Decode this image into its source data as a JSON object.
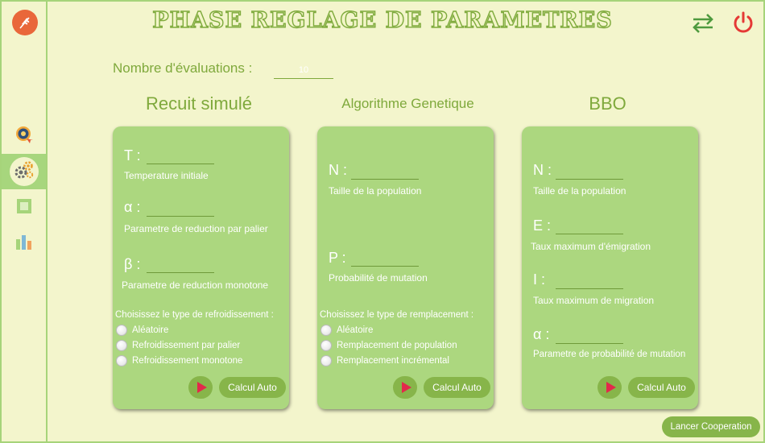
{
  "header": {
    "title": "PHASE REGLAGE DE PARAMETRES",
    "swap_icon": "swap-arrows-icon",
    "power_icon": "power-icon"
  },
  "sidebar": {
    "logo_icon": "wheat-logo-icon",
    "items": [
      {
        "icon": "quality-medal-icon",
        "active": false
      },
      {
        "icon": "gears-icon",
        "active": true
      },
      {
        "icon": "square-icon",
        "active": false
      },
      {
        "icon": "bar-chart-icon",
        "active": false
      }
    ]
  },
  "evaluations": {
    "label": "Nombre d'évaluations :",
    "value": "10"
  },
  "colors": {
    "background": "#f3f5cc",
    "card": "#acd77f",
    "accent_green": "#7fa93c",
    "button_green": "#87b54a",
    "play_red": "#e2294b",
    "power_red": "#e53935"
  },
  "recuit": {
    "title": "Recuit simulé",
    "params": [
      {
        "symbol": "T :",
        "description": "Temperature initiale"
      },
      {
        "symbol": "α :",
        "description": "Parametre de reduction par palier"
      },
      {
        "symbol": "β :",
        "description": "Parametre de reduction monotone"
      }
    ],
    "choose_label": "Choisissez le type de refroidissement :",
    "options": [
      "Aléatoire",
      "Refroidissement par palier",
      "Refroidissement monotone"
    ],
    "calc_label": "Calcul Auto"
  },
  "genetique": {
    "title": "Algorithme Genetique",
    "params": [
      {
        "symbol": "N :",
        "description": "Taille de la population"
      },
      {
        "symbol": "P :",
        "description": "Probabilité de mutation"
      }
    ],
    "choose_label": "Choisissez le type de remplacement :",
    "options": [
      "Aléatoire",
      "Remplacement de population",
      "Remplacement incrémental"
    ],
    "calc_label": "Calcul Auto"
  },
  "bbo": {
    "title": "BBO",
    "params": [
      {
        "symbol": "N :",
        "description": "Taille de la population"
      },
      {
        "symbol": "E :",
        "description": "Taux maximum d'émigration"
      },
      {
        "symbol": "I :",
        "description": "Taux maximum de migration"
      },
      {
        "symbol": "α :",
        "description": "Parametre de probabilité de mutation"
      }
    ],
    "calc_label": "Calcul Auto"
  },
  "footer": {
    "launch_label": "Lancer Cooperation"
  }
}
